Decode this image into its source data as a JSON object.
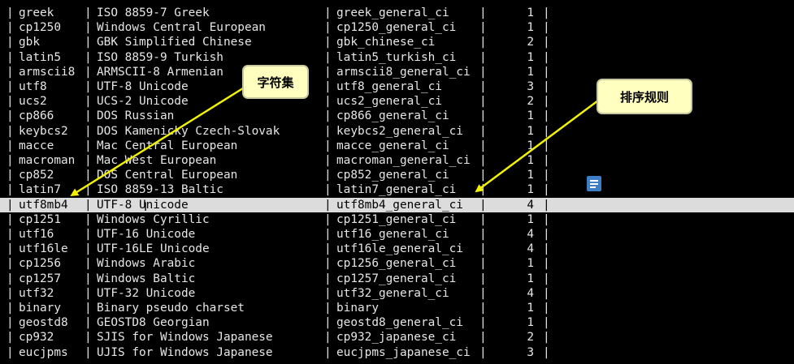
{
  "table": {
    "separator": "|",
    "highlighted_row_index": 13,
    "rows": [
      {
        "charset": "greek",
        "description": "ISO 8859-7 Greek",
        "default_collation": "greek_general_ci",
        "maxlen": "1"
      },
      {
        "charset": "cp1250",
        "description": "Windows Central European",
        "default_collation": "cp1250_general_ci",
        "maxlen": "1"
      },
      {
        "charset": "gbk",
        "description": "GBK Simplified Chinese",
        "default_collation": "gbk_chinese_ci",
        "maxlen": "2"
      },
      {
        "charset": "latin5",
        "description": "ISO 8859-9 Turkish",
        "default_collation": "latin5_turkish_ci",
        "maxlen": "1"
      },
      {
        "charset": "armscii8",
        "description": "ARMSCII-8 Armenian",
        "default_collation": "armscii8_general_ci",
        "maxlen": "1"
      },
      {
        "charset": "utf8",
        "description": "UTF-8 Unicode",
        "default_collation": "utf8_general_ci",
        "maxlen": "3"
      },
      {
        "charset": "ucs2",
        "description": "UCS-2 Unicode",
        "default_collation": "ucs2_general_ci",
        "maxlen": "2"
      },
      {
        "charset": "cp866",
        "description": "DOS Russian",
        "default_collation": "cp866_general_ci",
        "maxlen": "1"
      },
      {
        "charset": "keybcs2",
        "description": "DOS Kamenicky Czech-Slovak",
        "default_collation": "keybcs2_general_ci",
        "maxlen": "1"
      },
      {
        "charset": "macce",
        "description": "Mac Central European",
        "default_collation": "macce_general_ci",
        "maxlen": "1"
      },
      {
        "charset": "macroman",
        "description": "Mac West European",
        "default_collation": "macroman_general_ci",
        "maxlen": "1"
      },
      {
        "charset": "cp852",
        "description": "DOS Central European",
        "default_collation": "cp852_general_ci",
        "maxlen": "1"
      },
      {
        "charset": "latin7",
        "description": "ISO 8859-13 Baltic",
        "default_collation": "latin7_general_ci",
        "maxlen": "1"
      },
      {
        "charset": "utf8mb4",
        "description": "UTF-8 Unicode",
        "default_collation": "utf8mb4_general_ci",
        "maxlen": "4"
      },
      {
        "charset": "cp1251",
        "description": "Windows Cyrillic",
        "default_collation": "cp1251_general_ci",
        "maxlen": "1"
      },
      {
        "charset": "utf16",
        "description": "UTF-16 Unicode",
        "default_collation": "utf16_general_ci",
        "maxlen": "4"
      },
      {
        "charset": "utf16le",
        "description": "UTF-16LE Unicode",
        "default_collation": "utf16le_general_ci",
        "maxlen": "4"
      },
      {
        "charset": "cp1256",
        "description": "Windows Arabic",
        "default_collation": "cp1256_general_ci",
        "maxlen": "1"
      },
      {
        "charset": "cp1257",
        "description": "Windows Baltic",
        "default_collation": "cp1257_general_ci",
        "maxlen": "1"
      },
      {
        "charset": "utf32",
        "description": "UTF-32 Unicode",
        "default_collation": "utf32_general_ci",
        "maxlen": "4"
      },
      {
        "charset": "binary",
        "description": "Binary pseudo charset",
        "default_collation": "binary",
        "maxlen": "1"
      },
      {
        "charset": "geostd8",
        "description": "GEOSTD8 Georgian",
        "default_collation": "geostd8_general_ci",
        "maxlen": "1"
      },
      {
        "charset": "cp932",
        "description": "SJIS for Windows Japanese",
        "default_collation": "cp932_japanese_ci",
        "maxlen": "2"
      },
      {
        "charset": "eucjpms",
        "description": "UJIS for Windows Japanese",
        "default_collation": "eucjpms_japanese_ci",
        "maxlen": "3"
      }
    ]
  },
  "annotations": {
    "charset_label": "字符集",
    "collation_label": "排序规则",
    "arrow_color": "#f2f200"
  },
  "colors": {
    "terminal_bg": "#000000",
    "terminal_text": "#e6e6e6",
    "highlight_bg": "#dcdcdc",
    "callout_bg": "#ffffc0"
  },
  "icons": {
    "desktop_icon": "document-icon",
    "mouse_cursor": "text-cursor-icon"
  }
}
